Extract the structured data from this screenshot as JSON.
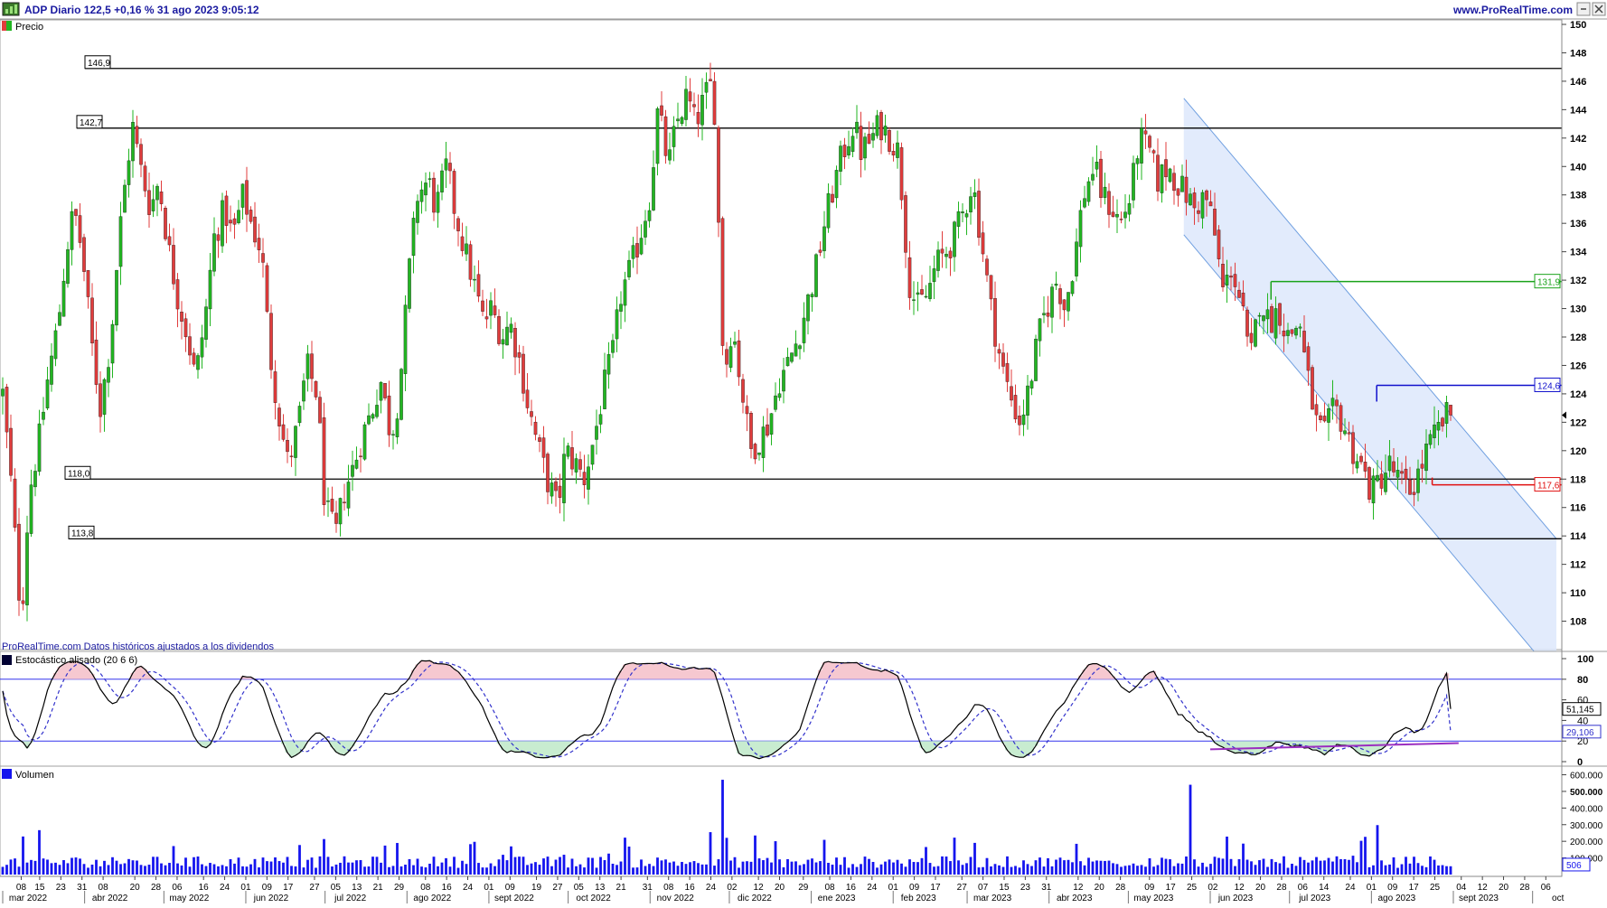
{
  "header": {
    "title": "ADP Diario 122,5 +0,16 % 31 ago 2023 9:05:12",
    "website": "www.ProRealTime.com"
  },
  "price_panel": {
    "label": "Precio",
    "footnote": "ProRealTime.com Datos históricos ajustados a los dividendos"
  },
  "stoch_panel": {
    "label": "Estocástico alisado (20 6 6)"
  },
  "volume_panel": {
    "label": "Volumen"
  },
  "colors": {
    "bull": "#22b522",
    "bear": "#e03c3c",
    "hline": "#000000",
    "resist_green": "#1aa31a",
    "resist_blue": "#1010cc",
    "support_red": "#e01010",
    "channel_fill": "#dde8fb",
    "channel_edge": "#6f9fe0",
    "stoch_k": "#000000",
    "stoch_d": "#3333cc",
    "stoch_level": "#3333ee",
    "overbought_fill": "#f6c8d0",
    "oversold_fill": "#c8ecd0",
    "divergence": "#9b2fbf",
    "volume_bar": "#1515ee"
  },
  "chart_data": [
    {
      "type": "candlestick",
      "symbol": "ADP",
      "timeframe": "Diario",
      "last": "122,5",
      "change": "+0,16 %",
      "datetime": "31 ago 2023 9:05:12",
      "ylim": [
        106,
        150
      ],
      "y_ticks": [
        "108",
        "110",
        "112",
        "114",
        "116",
        "118",
        "120",
        "122",
        "124",
        "126",
        "128",
        "130",
        "132",
        "134",
        "136",
        "138",
        "140",
        "142",
        "144",
        "146",
        "148",
        "150"
      ],
      "horizontal_levels": [
        {
          "label": "146,9",
          "value": 146.9
        },
        {
          "label": "142,7",
          "value": 142.7
        },
        {
          "label": "118,0",
          "value": 118.0
        },
        {
          "label": "113,8",
          "value": 113.8
        }
      ],
      "right_levels": [
        {
          "label": "131,9",
          "value": 131.9,
          "color": "green"
        },
        {
          "label": "124,6",
          "value": 124.6,
          "color": "blue"
        },
        {
          "label": "117,6",
          "value": 117.6,
          "color": "red"
        }
      ],
      "channel": {
        "start_date": "2023-05-22",
        "end_date": "2023-10-10",
        "upper_start": 144.8,
        "upper_end": 113.8,
        "lower_start": 135.2,
        "lower_end": 104.0
      },
      "price_path": [
        [
          "2022-03-01",
          124
        ],
        [
          "2022-03-04",
          118
        ],
        [
          "2022-03-08",
          108
        ],
        [
          "2022-03-11",
          117
        ],
        [
          "2022-03-15",
          121
        ],
        [
          "2022-03-18",
          125
        ],
        [
          "2022-03-22",
          129
        ],
        [
          "2022-03-25",
          134
        ],
        [
          "2022-03-28",
          137
        ],
        [
          "2022-03-31",
          134
        ],
        [
          "2022-04-04",
          127
        ],
        [
          "2022-04-07",
          123
        ],
        [
          "2022-04-11",
          128
        ],
        [
          "2022-04-14",
          135
        ],
        [
          "2022-04-19",
          143
        ],
        [
          "2022-04-22",
          140
        ],
        [
          "2022-04-26",
          137
        ],
        [
          "2022-04-29",
          139
        ],
        [
          "2022-05-03",
          134
        ],
        [
          "2022-05-06",
          131
        ],
        [
          "2022-05-10",
          128
        ],
        [
          "2022-05-13",
          125
        ],
        [
          "2022-05-17",
          130
        ],
        [
          "2022-05-20",
          135
        ],
        [
          "2022-05-24",
          137
        ],
        [
          "2022-05-27",
          135
        ],
        [
          "2022-05-31",
          138
        ],
        [
          "2022-06-03",
          136
        ],
        [
          "2022-06-07",
          134
        ],
        [
          "2022-06-10",
          127
        ],
        [
          "2022-06-14",
          122
        ],
        [
          "2022-06-17",
          119
        ],
        [
          "2022-06-21",
          122
        ],
        [
          "2022-06-24",
          126
        ],
        [
          "2022-06-28",
          124
        ],
        [
          "2022-07-01",
          116
        ],
        [
          "2022-07-05",
          114
        ],
        [
          "2022-07-08",
          117
        ],
        [
          "2022-07-12",
          119
        ],
        [
          "2022-07-15",
          121
        ],
        [
          "2022-07-19",
          123
        ],
        [
          "2022-07-22",
          125
        ],
        [
          "2022-07-26",
          121
        ],
        [
          "2022-07-29",
          124
        ],
        [
          "2022-08-02",
          133
        ],
        [
          "2022-08-05",
          138
        ],
        [
          "2022-08-09",
          139
        ],
        [
          "2022-08-12",
          137
        ],
        [
          "2022-08-16",
          140
        ],
        [
          "2022-08-19",
          137
        ],
        [
          "2022-08-23",
          134
        ],
        [
          "2022-08-26",
          132
        ],
        [
          "2022-08-30",
          129
        ],
        [
          "2022-09-02",
          130
        ],
        [
          "2022-09-06",
          128
        ],
        [
          "2022-09-09",
          129
        ],
        [
          "2022-09-13",
          126
        ],
        [
          "2022-09-16",
          123
        ],
        [
          "2022-09-20",
          120
        ],
        [
          "2022-09-23",
          118
        ],
        [
          "2022-09-27",
          116
        ],
        [
          "2022-09-30",
          120
        ],
        [
          "2022-10-04",
          119
        ],
        [
          "2022-10-07",
          118
        ],
        [
          "2022-10-11",
          121
        ],
        [
          "2022-10-14",
          124
        ],
        [
          "2022-10-18",
          127
        ],
        [
          "2022-10-21",
          131
        ],
        [
          "2022-10-25",
          133
        ],
        [
          "2022-10-28",
          135
        ],
        [
          "2022-11-01",
          138
        ],
        [
          "2022-11-04",
          144
        ],
        [
          "2022-11-08",
          140
        ],
        [
          "2022-11-11",
          143
        ],
        [
          "2022-11-15",
          145
        ],
        [
          "2022-11-18",
          143
        ],
        [
          "2022-11-22",
          145
        ],
        [
          "2022-11-25",
          146
        ],
        [
          "2022-11-29",
          125
        ],
        [
          "2022-12-02",
          129
        ],
        [
          "2022-12-06",
          124
        ],
        [
          "2022-12-09",
          120
        ],
        [
          "2022-12-13",
          121
        ],
        [
          "2022-12-16",
          122
        ],
        [
          "2022-12-20",
          125
        ],
        [
          "2022-12-23",
          126
        ],
        [
          "2022-12-27",
          128
        ],
        [
          "2022-12-30",
          130
        ],
        [
          "2023-01-03",
          133
        ],
        [
          "2023-01-06",
          136
        ],
        [
          "2023-01-10",
          139
        ],
        [
          "2023-01-13",
          141
        ],
        [
          "2023-01-17",
          143
        ],
        [
          "2023-01-20",
          141
        ],
        [
          "2023-01-24",
          142
        ],
        [
          "2023-01-27",
          143
        ],
        [
          "2023-01-31",
          142
        ],
        [
          "2023-02-03",
          141
        ],
        [
          "2023-02-07",
          132
        ],
        [
          "2023-02-10",
          130
        ],
        [
          "2023-02-14",
          131
        ],
        [
          "2023-02-17",
          133
        ],
        [
          "2023-02-21",
          134
        ],
        [
          "2023-02-24",
          135
        ],
        [
          "2023-02-28",
          137
        ],
        [
          "2023-03-03",
          139
        ],
        [
          "2023-03-07",
          134
        ],
        [
          "2023-03-10",
          130
        ],
        [
          "2023-03-14",
          126
        ],
        [
          "2023-03-17",
          124
        ],
        [
          "2023-03-21",
          122
        ],
        [
          "2023-03-24",
          124
        ],
        [
          "2023-03-28",
          128
        ],
        [
          "2023-03-31",
          130
        ],
        [
          "2023-04-04",
          132
        ],
        [
          "2023-04-07",
          130
        ],
        [
          "2023-04-11",
          134
        ],
        [
          "2023-04-14",
          138
        ],
        [
          "2023-04-18",
          140
        ],
        [
          "2023-04-21",
          138
        ],
        [
          "2023-04-25",
          137
        ],
        [
          "2023-04-28",
          136
        ],
        [
          "2023-05-02",
          138
        ],
        [
          "2023-05-05",
          142
        ],
        [
          "2023-05-09",
          141
        ],
        [
          "2023-05-12",
          139
        ],
        [
          "2023-05-16",
          140
        ],
        [
          "2023-05-19",
          139
        ],
        [
          "2023-05-23",
          138
        ],
        [
          "2023-05-26",
          137
        ],
        [
          "2023-05-30",
          138
        ],
        [
          "2023-06-02",
          136
        ],
        [
          "2023-06-06",
          131
        ],
        [
          "2023-06-09",
          133
        ],
        [
          "2023-06-13",
          130
        ],
        [
          "2023-06-16",
          126
        ],
        [
          "2023-06-20",
          131
        ],
        [
          "2023-06-23",
          129
        ],
        [
          "2023-06-27",
          130
        ],
        [
          "2023-06-30",
          128
        ],
        [
          "2023-07-05",
          129
        ],
        [
          "2023-07-07",
          126
        ],
        [
          "2023-07-11",
          122
        ],
        [
          "2023-07-14",
          121
        ],
        [
          "2023-07-18",
          123
        ],
        [
          "2023-07-21",
          122
        ],
        [
          "2023-07-25",
          120
        ],
        [
          "2023-07-28",
          119
        ],
        [
          "2023-08-01",
          117
        ],
        [
          "2023-08-04",
          118
        ],
        [
          "2023-08-08",
          119
        ],
        [
          "2023-08-11",
          118
        ],
        [
          "2023-08-15",
          117
        ],
        [
          "2023-08-18",
          118
        ],
        [
          "2023-08-22",
          120
        ],
        [
          "2023-08-25",
          121
        ],
        [
          "2023-08-29",
          122.4
        ],
        [
          "2023-08-31",
          122.5
        ]
      ]
    },
    {
      "type": "line",
      "name": "Estocástico alisado (20 6 6)",
      "ylim": [
        0,
        100
      ],
      "y_ticks": [
        "0",
        "20",
        "40",
        "60",
        "80",
        "100"
      ],
      "levels": [
        20,
        80
      ],
      "last_k": "51,145",
      "last_d": "29,106",
      "divergence_line": {
        "start": [
          "2023-06-01",
          12
        ],
        "end": [
          "2023-09-03",
          18
        ]
      }
    },
    {
      "type": "bar",
      "name": "Volumen",
      "ylim": [
        0,
        630000
      ],
      "y_ticks": [
        "100.000",
        "200.000",
        "300.000",
        "400.000",
        "500.000",
        "600.000"
      ],
      "last_value": "506",
      "spikes": [
        [
          "2022-11-29",
          570000
        ],
        [
          "2023-05-25",
          540000
        ]
      ]
    }
  ],
  "x_axis": {
    "day_ticks": [
      [
        "2022-03-08",
        "08"
      ],
      [
        "2022-03-15",
        "15"
      ],
      [
        "2022-03-23",
        "23"
      ],
      [
        "2022-03-31",
        "31"
      ],
      [
        "2022-04-08",
        "08"
      ],
      [
        "2022-04-20",
        "20"
      ],
      [
        "2022-04-28",
        "28"
      ],
      [
        "2022-05-06",
        "06"
      ],
      [
        "2022-05-16",
        "16"
      ],
      [
        "2022-05-24",
        "24"
      ],
      [
        "2022-06-01",
        "01"
      ],
      [
        "2022-06-09",
        "09"
      ],
      [
        "2022-06-17",
        "17"
      ],
      [
        "2022-06-27",
        "27"
      ],
      [
        "2022-07-05",
        "05"
      ],
      [
        "2022-07-13",
        "13"
      ],
      [
        "2022-07-21",
        "21"
      ],
      [
        "2022-07-29",
        "29"
      ],
      [
        "2022-08-08",
        "08"
      ],
      [
        "2022-08-16",
        "16"
      ],
      [
        "2022-08-24",
        "24"
      ],
      [
        "2022-09-01",
        "01"
      ],
      [
        "2022-09-09",
        "09"
      ],
      [
        "2022-09-19",
        "19"
      ],
      [
        "2022-09-27",
        "27"
      ],
      [
        "2022-10-05",
        "05"
      ],
      [
        "2022-10-13",
        "13"
      ],
      [
        "2022-10-21",
        "21"
      ],
      [
        "2022-10-31",
        "31"
      ],
      [
        "2022-11-08",
        "08"
      ],
      [
        "2022-11-16",
        "16"
      ],
      [
        "2022-11-24",
        "24"
      ],
      [
        "2022-12-02",
        "02"
      ],
      [
        "2022-12-12",
        "12"
      ],
      [
        "2022-12-20",
        "20"
      ],
      [
        "2022-12-29",
        "29"
      ],
      [
        "2023-01-08",
        "08"
      ],
      [
        "2023-01-16",
        "16"
      ],
      [
        "2023-01-24",
        "24"
      ],
      [
        "2023-02-01",
        "01"
      ],
      [
        "2023-02-09",
        "09"
      ],
      [
        "2023-02-17",
        "17"
      ],
      [
        "2023-02-27",
        "27"
      ],
      [
        "2023-03-07",
        "07"
      ],
      [
        "2023-03-15",
        "15"
      ],
      [
        "2023-03-23",
        "23"
      ],
      [
        "2023-03-31",
        "31"
      ],
      [
        "2023-04-12",
        "12"
      ],
      [
        "2023-04-20",
        "20"
      ],
      [
        "2023-04-28",
        "28"
      ],
      [
        "2023-05-09",
        "09"
      ],
      [
        "2023-05-17",
        "17"
      ],
      [
        "2023-05-25",
        "25"
      ],
      [
        "2023-06-02",
        "02"
      ],
      [
        "2023-06-12",
        "12"
      ],
      [
        "2023-06-20",
        "20"
      ],
      [
        "2023-06-28",
        "28"
      ],
      [
        "2023-07-06",
        "06"
      ],
      [
        "2023-07-14",
        "14"
      ],
      [
        "2023-07-24",
        "24"
      ],
      [
        "2023-08-01",
        "01"
      ],
      [
        "2023-08-09",
        "09"
      ],
      [
        "2023-08-17",
        "17"
      ],
      [
        "2023-08-25",
        "25"
      ],
      [
        "2023-09-04",
        "04"
      ],
      [
        "2023-09-12",
        "12"
      ],
      [
        "2023-09-20",
        "20"
      ],
      [
        "2023-09-28",
        "28"
      ],
      [
        "2023-10-06",
        "06"
      ]
    ],
    "month_ticks": [
      [
        "2022-03-01",
        "mar 2022"
      ],
      [
        "2022-04-01",
        "abr 2022"
      ],
      [
        "2022-05-01",
        "may 2022"
      ],
      [
        "2022-06-01",
        "jun 2022"
      ],
      [
        "2022-07-01",
        "jul 2022"
      ],
      [
        "2022-08-01",
        "ago 2022"
      ],
      [
        "2022-09-01",
        "sept 2022"
      ],
      [
        "2022-10-01",
        "oct 2022"
      ],
      [
        "2022-11-01",
        "nov 2022"
      ],
      [
        "2022-12-01",
        "dic 2022"
      ],
      [
        "2023-01-01",
        "ene 2023"
      ],
      [
        "2023-02-01",
        "feb 2023"
      ],
      [
        "2023-03-01",
        "mar 2023"
      ],
      [
        "2023-04-01",
        "abr 2023"
      ],
      [
        "2023-05-01",
        "may 2023"
      ],
      [
        "2023-06-01",
        "jun 2023"
      ],
      [
        "2023-07-01",
        "jul 2023"
      ],
      [
        "2023-08-01",
        "ago 2023"
      ],
      [
        "2023-09-01",
        "sept 2023"
      ],
      [
        "2023-10-01",
        "oct"
      ]
    ]
  }
}
